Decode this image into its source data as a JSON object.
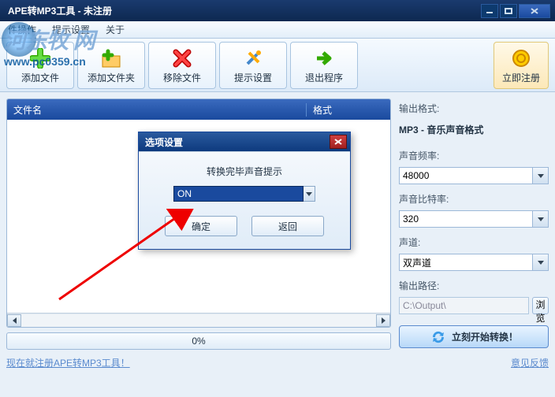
{
  "window": {
    "title": "APE转MP3工具 - 未注册"
  },
  "menu": {
    "item1": "件操作",
    "item2": "提示设置",
    "item3": "关于"
  },
  "watermark": {
    "text": "河东牧  网",
    "url": "www.pc0359.cn"
  },
  "toolbar": {
    "add_file": "添加文件",
    "add_folder": "添加文件夹",
    "remove": "移除文件",
    "settings": "提示设置",
    "exit": "退出程序",
    "register": "立即注册"
  },
  "list": {
    "col_name": "文件名",
    "col_format": "格式"
  },
  "progress": {
    "text": "0%"
  },
  "reg_link": "现在就注册APE转MP3工具！",
  "right": {
    "output_format_label": "输出格式:",
    "output_format": "MP3 - 音乐声音格式",
    "sample_rate_label": "声音频率:",
    "sample_rate": "48000",
    "bitrate_label": "声音比特率:",
    "bitrate": "320",
    "channel_label": "声道:",
    "channel": "双声道",
    "output_path_label": "输出路径:",
    "output_path": "C:\\Output\\",
    "browse": "浏览",
    "start": "立刻开始转换！",
    "feedback": "意见反馈"
  },
  "dialog": {
    "title": "选项设置",
    "prompt_label": "转换完毕声音提示",
    "value": "ON",
    "ok": "确定",
    "cancel": "返回"
  }
}
